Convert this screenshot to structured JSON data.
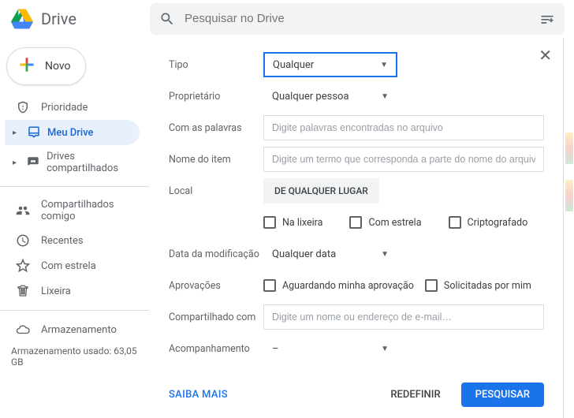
{
  "header": {
    "product": "Drive",
    "search_placeholder": "Pesquisar no Drive"
  },
  "sidebar": {
    "new_label": "Novo",
    "items_top": {
      "priority": "Prioridade",
      "my_drive": "Meu Drive",
      "shared_drives": "Drives compartilhados"
    },
    "items_mid": {
      "shared_with_me": "Compartilhados comigo",
      "recent": "Recentes",
      "starred": "Com estrela",
      "trash": "Lixeira"
    },
    "storage": {
      "label": "Armazenamento",
      "used_text": "Armazenamento usado: 63,05 GB"
    }
  },
  "dialog": {
    "labels": {
      "type": "Tipo",
      "owner": "Proprietário",
      "has_words": "Com as palavras",
      "item_name": "Nome do item",
      "location": "Local",
      "date_modified": "Data da modificação",
      "approvals": "Aprovações",
      "shared_with": "Compartilhado com",
      "follow_up": "Acompanhamento"
    },
    "values": {
      "type_selected": "Qualquer",
      "owner_selected": "Qualquer pessoa",
      "location_chip": "DE QUALQUER LUGAR",
      "date_selected": "Qualquer data",
      "follow_up_selected": "–"
    },
    "placeholders": {
      "has_words": "Digite palavras encontradas no arquivo",
      "item_name": "Digite um termo que corresponda a parte do nome do arquivo",
      "shared_with": "Digite um nome ou endereço de e-mail…"
    },
    "checkboxes": {
      "in_trash": "Na lixeira",
      "starred": "Com estrela",
      "encrypted": "Criptografado",
      "awaiting_my_approval": "Aguardando minha aprovação",
      "requested_by_me": "Solicitadas por mim"
    },
    "footer": {
      "learn_more": "SAIBA MAIS",
      "reset": "REDEFINIR",
      "search": "PESQUISAR"
    }
  }
}
